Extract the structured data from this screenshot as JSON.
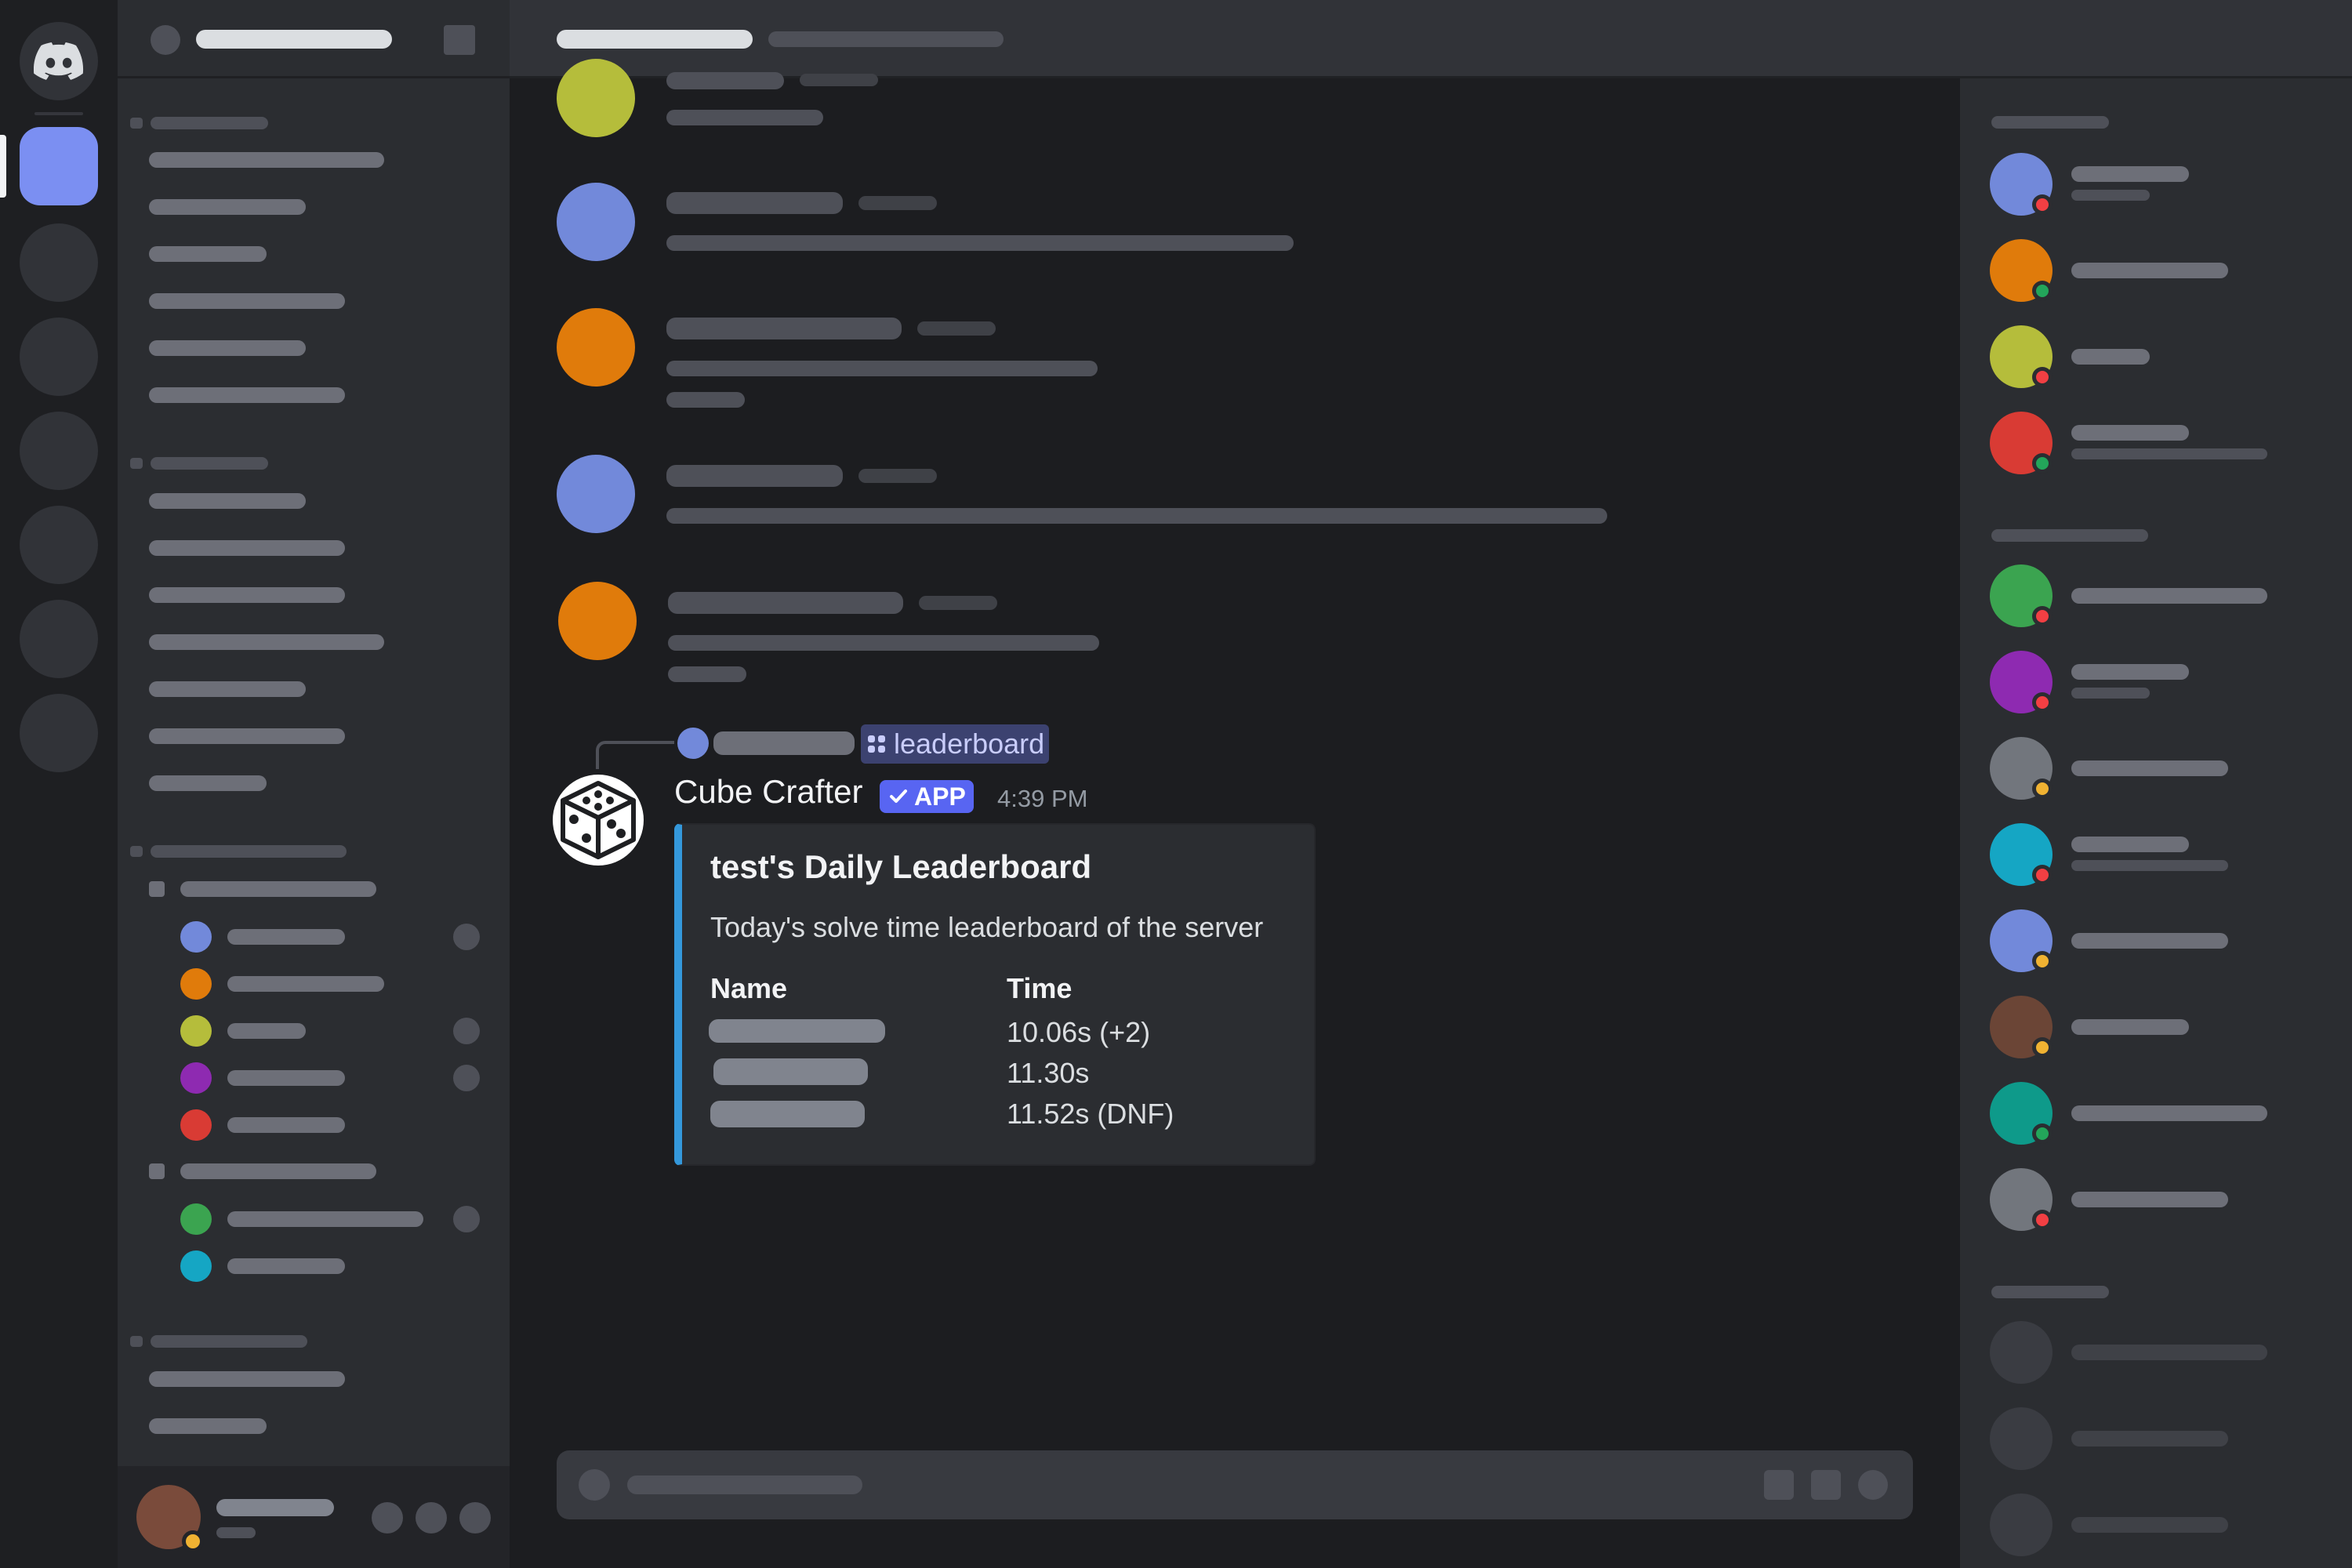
{
  "icons": {
    "app_logo": "discord-logo-icon",
    "bot_avatar": "dice-icon",
    "channel_mention": "grid-icon",
    "verified": "check-icon"
  },
  "colors": {
    "accent": "#5865f2",
    "embed_border": "#3498db",
    "status_online": "#23a55a",
    "status_idle": "#f0b232",
    "status_dnd": "#f23f43"
  },
  "message": {
    "mention_channel": "leaderboard",
    "author": "Cube Crafter",
    "badge": "APP",
    "timestamp": "4:39 PM",
    "embed": {
      "title": "test's Daily Leaderboard",
      "description": "Today's solve time leaderboard of the server",
      "fields": [
        {
          "name": "Name",
          "values": []
        },
        {
          "name": "Time",
          "values": [
            "10.06s (+2)",
            "11.30s",
            "11.52s (DNF)"
          ]
        }
      ]
    }
  }
}
